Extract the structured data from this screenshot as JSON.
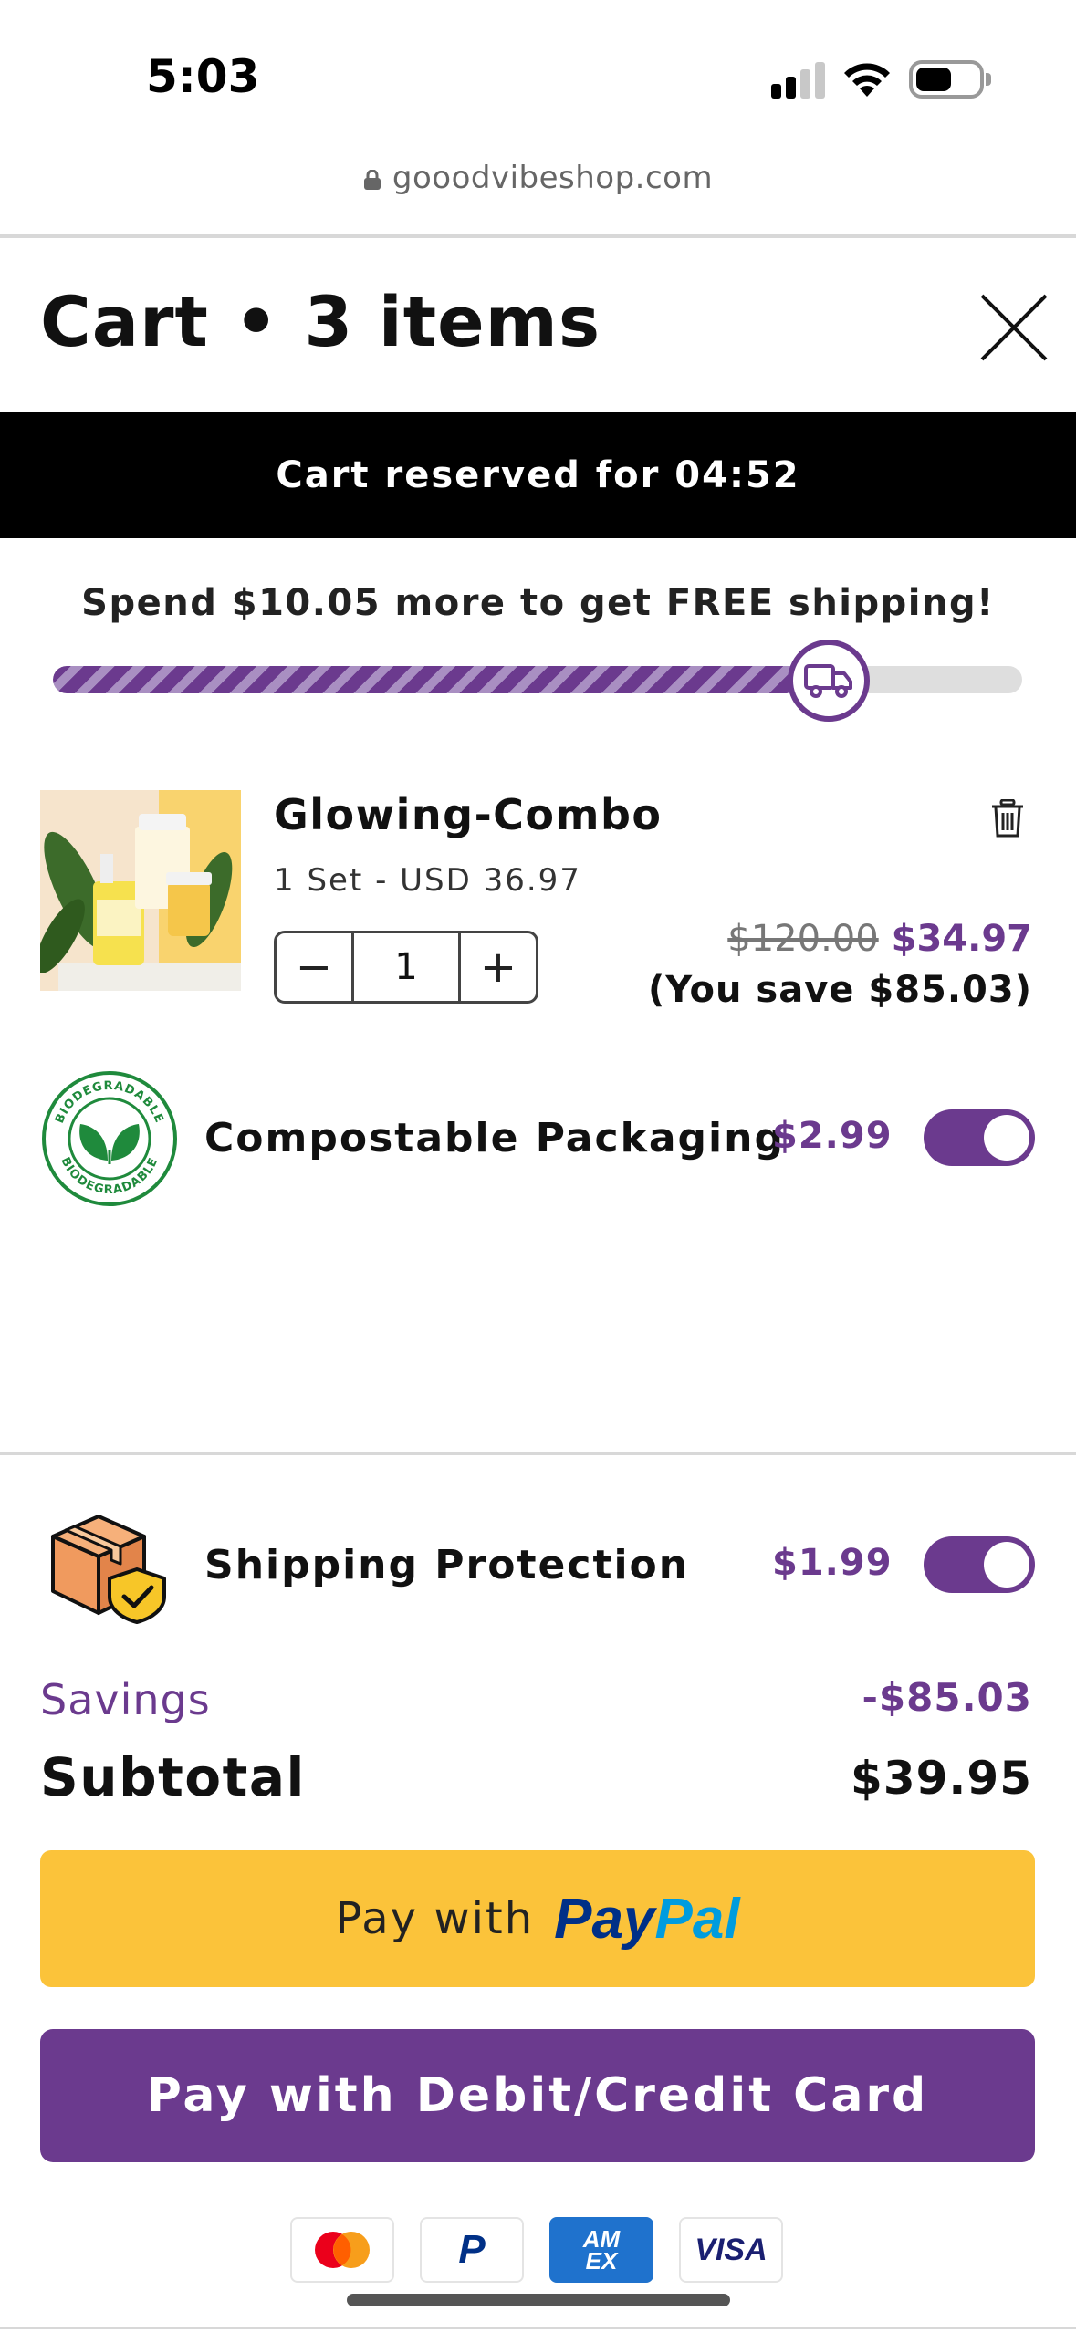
{
  "status_bar": {
    "time": "5:03"
  },
  "browser": {
    "url": "gooodvibeshop.com"
  },
  "cart": {
    "title": "Cart • 3 items",
    "reserved_text": "Cart reserved for 04:52",
    "free_shipping_text": "Spend $10.05 more to get FREE shipping!",
    "free_shipping_progress": 0.8
  },
  "product": {
    "name": "Glowing-Combo",
    "variant": "1 Set - USD 36.97",
    "quantity": "1",
    "minus_label": "−",
    "plus_label": "+",
    "original_price": "$120.00",
    "sale_price": "$34.97",
    "you_save": "(You save $85.03)"
  },
  "addons": {
    "compostable": {
      "label": "Compostable Packaging",
      "price": "$2.99",
      "enabled": true,
      "badge_text": "BIODEGRADABLE"
    },
    "shipping_protection": {
      "label": "Shipping Protection",
      "price": "$1.99",
      "enabled": true
    }
  },
  "summary": {
    "savings_label": "Savings",
    "savings_value": "-$85.03",
    "subtotal_label": "Subtotal",
    "subtotal_value": "$39.95"
  },
  "buttons": {
    "paypal_prefix": "Pay with",
    "paypal_brand_1": "Pay",
    "paypal_brand_2": "Pal",
    "card_label": "Pay with Debit/Credit Card"
  },
  "payment_methods": {
    "paypal_mini": "P",
    "amex_line1": "AM",
    "amex_line2": "EX",
    "visa": "VISA"
  },
  "colors": {
    "accent": "#6b3a8e",
    "paypal_yellow": "#fbc33a",
    "banner_black": "#000000"
  }
}
